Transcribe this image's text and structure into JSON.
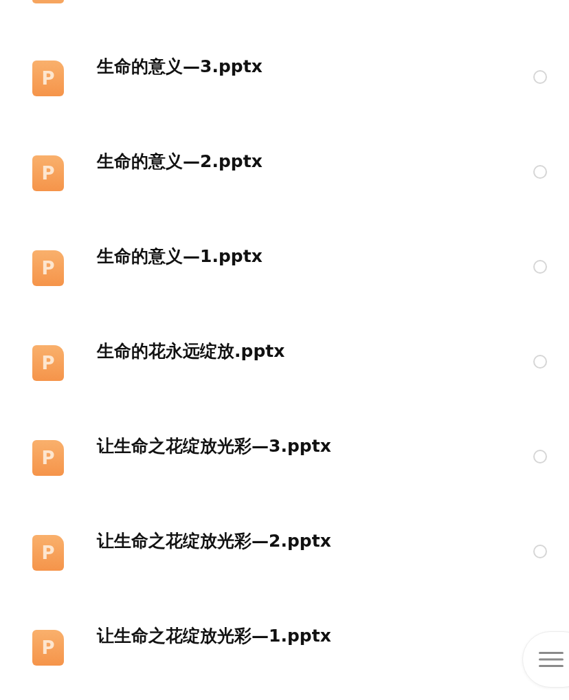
{
  "files": [
    {
      "name": "生命的意义—3.pptx",
      "icon": "P",
      "selected": false
    },
    {
      "name": "生命的意义—2.pptx",
      "icon": "P",
      "selected": false
    },
    {
      "name": "生命的意义—1.pptx",
      "icon": "P",
      "selected": false
    },
    {
      "name": "生命的花永远绽放.pptx",
      "icon": "P",
      "selected": false
    },
    {
      "name": "让生命之花绽放光彩—3.pptx",
      "icon": "P",
      "selected": false
    },
    {
      "name": "让生命之花绽放光彩—2.pptx",
      "icon": "P",
      "selected": false
    },
    {
      "name": "让生命之花绽放光彩—1.pptx",
      "icon": "P"
    }
  ]
}
